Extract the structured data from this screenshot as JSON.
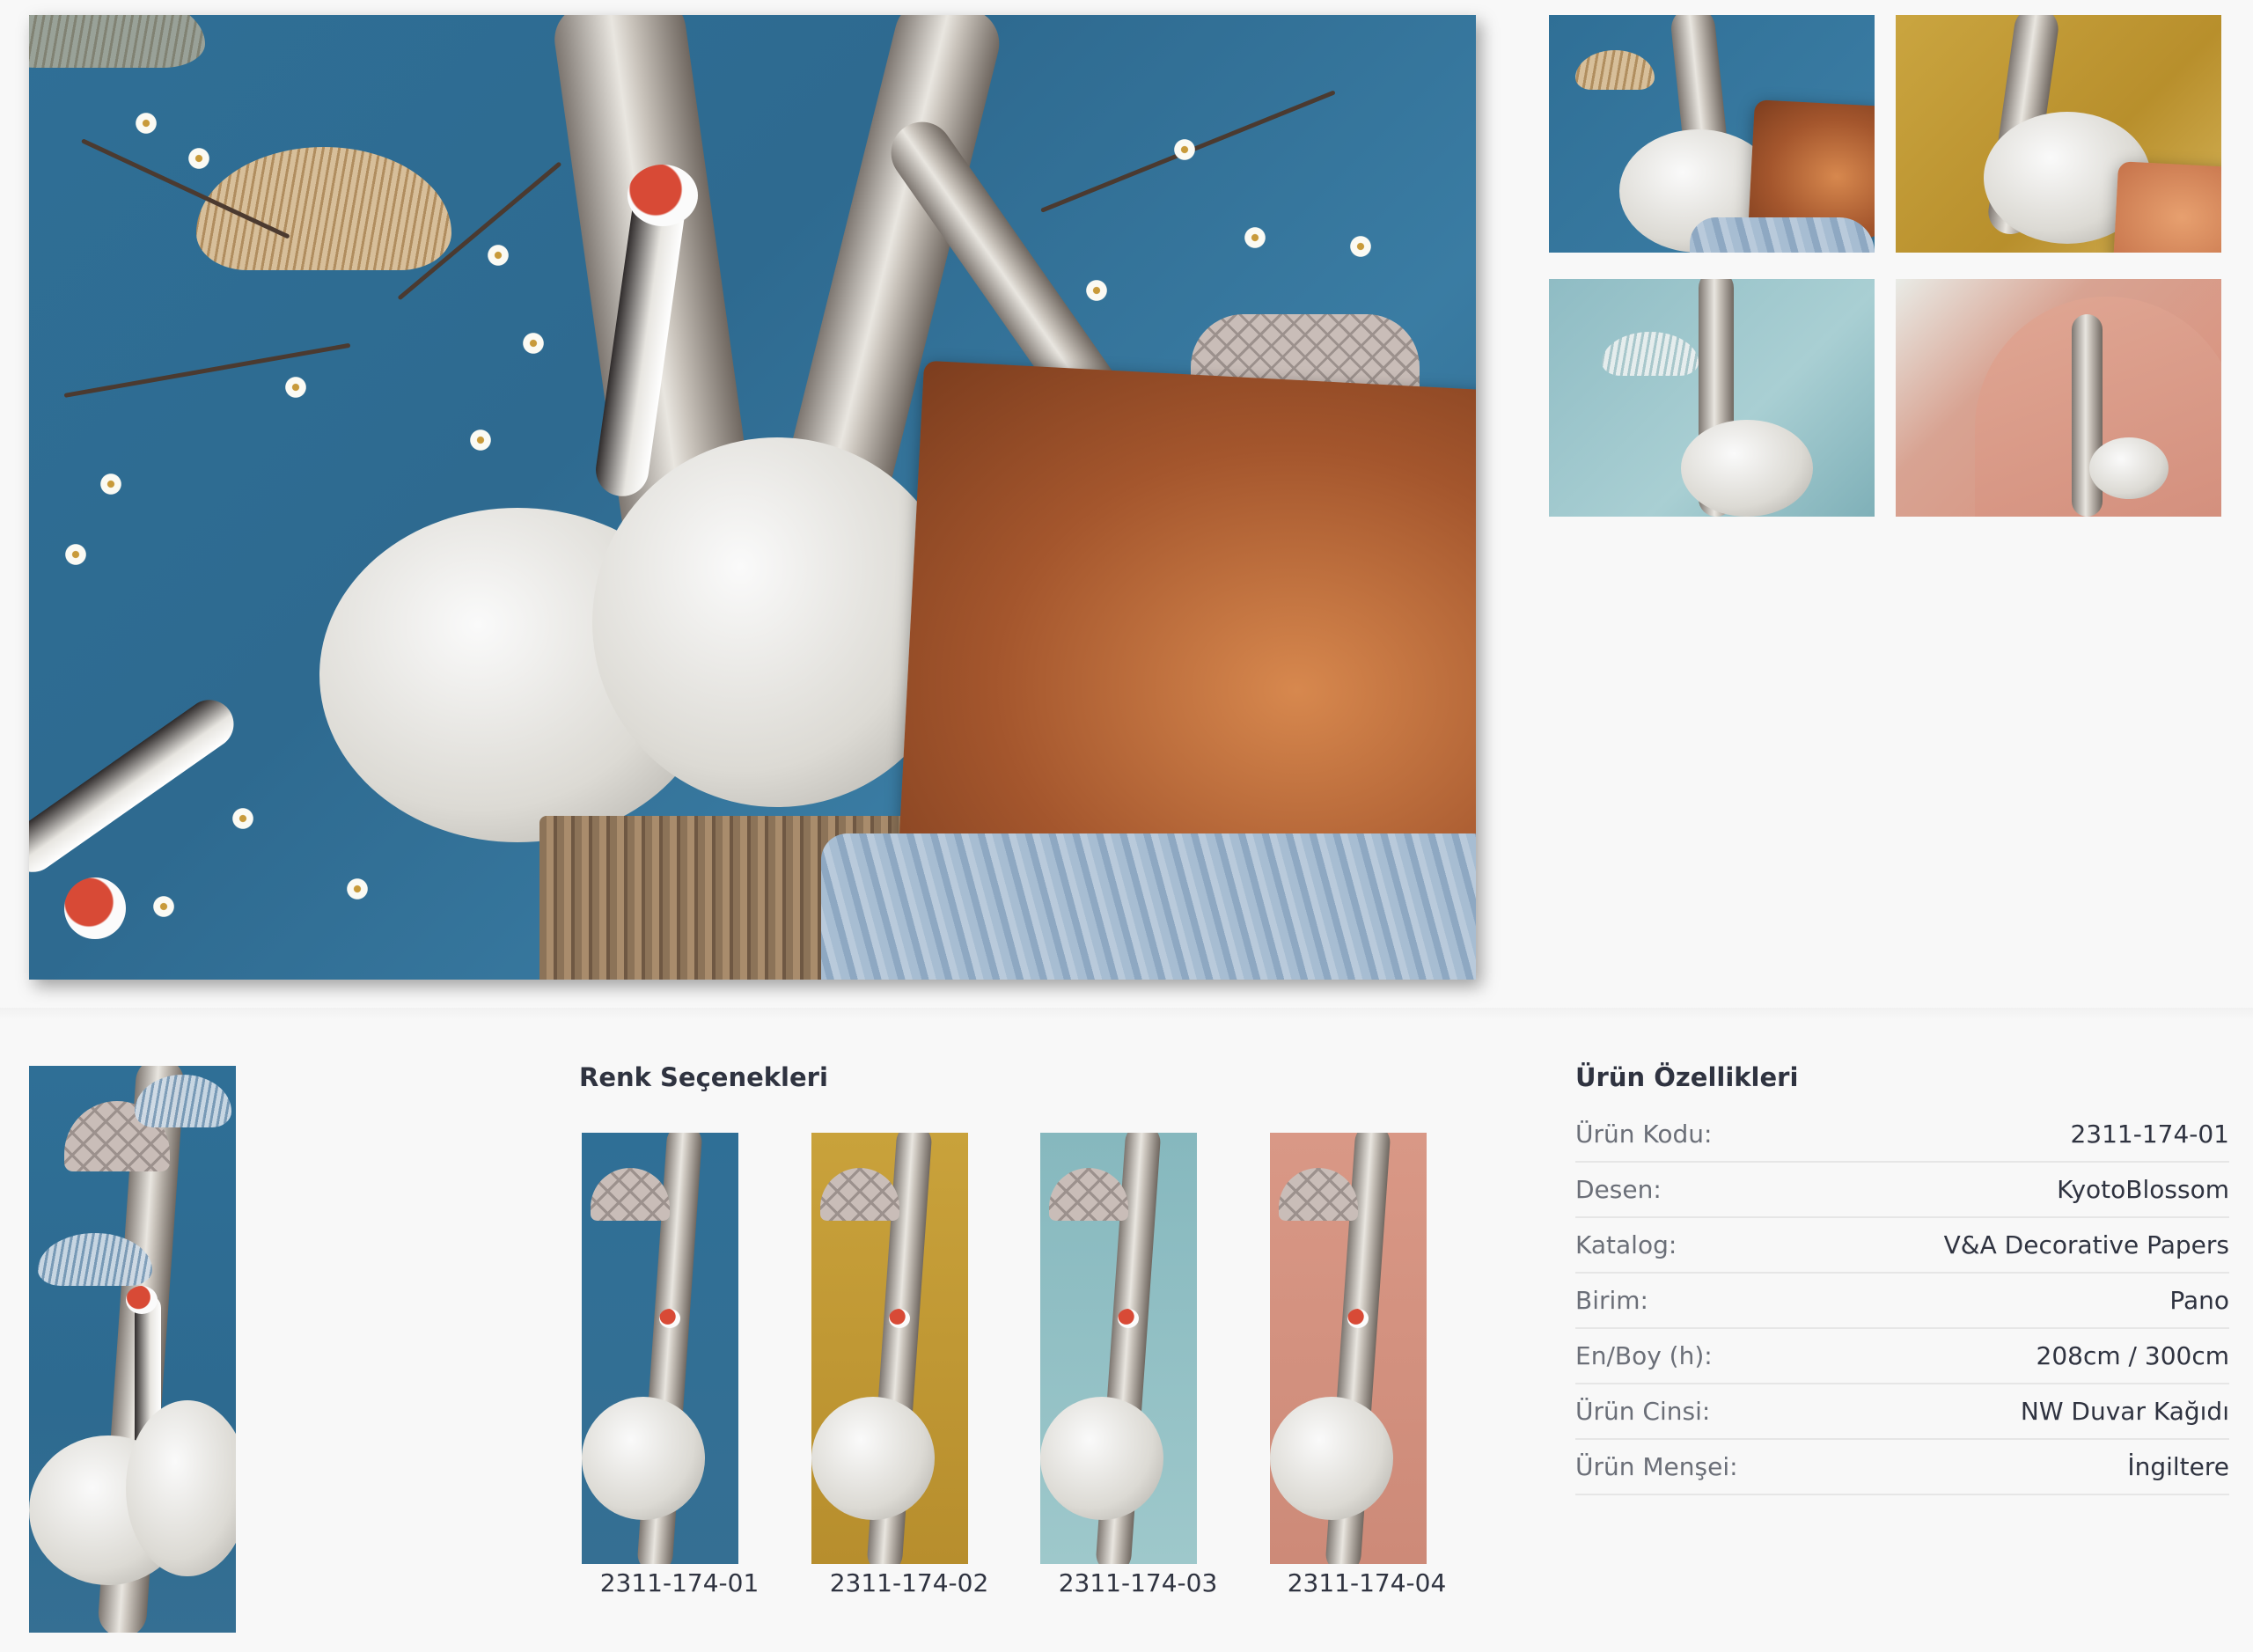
{
  "gallery": {
    "main_image": "wallpaper-crane-blue-room",
    "thumbnails": [
      {
        "name": "blue-room"
      },
      {
        "name": "yellow-room"
      },
      {
        "name": "aqua-room"
      },
      {
        "name": "pink-room"
      }
    ]
  },
  "panel_preview": {
    "name": "blue-panel"
  },
  "color_options": {
    "title": "Renk Seçenekleri",
    "items": [
      {
        "code": "2311-174-01",
        "color": "#2f6f96"
      },
      {
        "code": "2311-174-02",
        "color": "#c9a23b"
      },
      {
        "code": "2311-174-03",
        "color": "#86b8be"
      },
      {
        "code": "2311-174-04",
        "color": "#d99886"
      }
    ]
  },
  "specs": {
    "title": "Ürün Özellikleri",
    "rows": [
      {
        "label": "Ürün Kodu:",
        "value": "2311-174-01"
      },
      {
        "label": "Desen:",
        "value": "KyotoBlossom"
      },
      {
        "label": "Katalog:",
        "value": "V&A Decorative Papers"
      },
      {
        "label": "Birim:",
        "value": "Pano"
      },
      {
        "label": "En/Boy (h):",
        "value": "208cm / 300cm"
      },
      {
        "label": "Ürün Cinsi:",
        "value": "NW Duvar Kağıdı"
      },
      {
        "label": "Ürün Menşei:",
        "value": "İngiltere"
      }
    ]
  }
}
